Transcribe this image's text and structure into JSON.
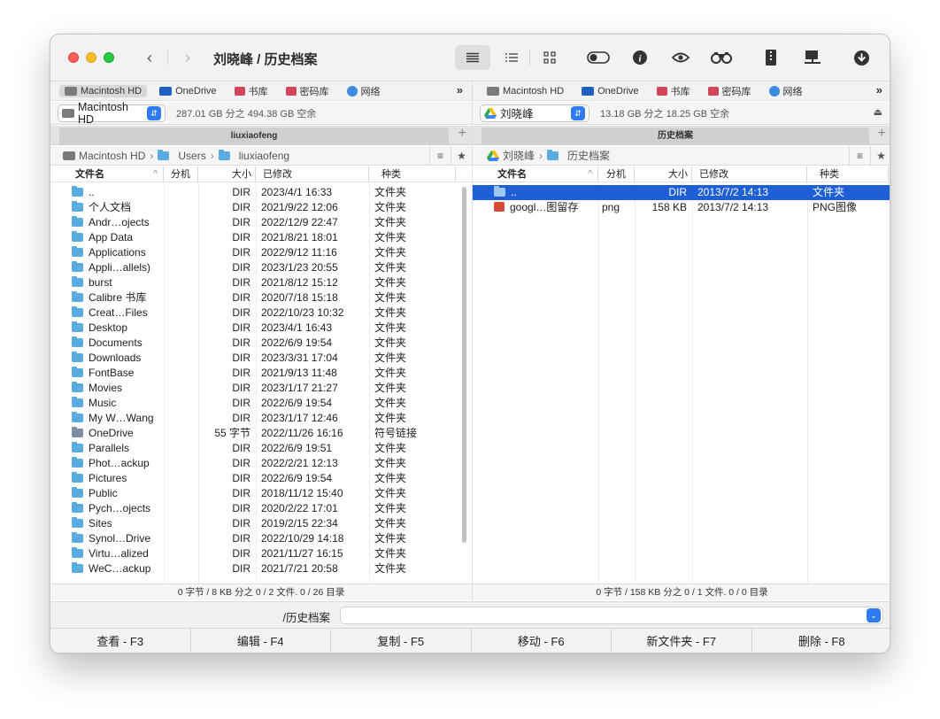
{
  "window": {
    "title": "刘晓峰 / 历史档案"
  },
  "toolbar": {
    "icons": [
      "list-view-icon",
      "detail-view-icon",
      "grid-view-icon",
      "toggle-icon",
      "info-icon",
      "eye-icon",
      "binoculars-icon",
      "archive-icon",
      "network-drive-icon",
      "download-icon"
    ]
  },
  "volumes_left": [
    {
      "label": "Macintosh HD",
      "icon": "hdd-icon",
      "selected": true
    },
    {
      "label": "OneDrive",
      "icon": "drive-icon",
      "selected": false
    },
    {
      "label": "书库",
      "icon": "drive-icon",
      "selected": false
    },
    {
      "label": "密码库",
      "icon": "drive-icon",
      "selected": false
    },
    {
      "label": "网络",
      "icon": "globe-icon",
      "selected": false
    }
  ],
  "volumes_right": [
    {
      "label": "Macintosh HD",
      "icon": "hdd-icon",
      "selected": false
    },
    {
      "label": "OneDrive",
      "icon": "drive-icon",
      "selected": false
    },
    {
      "label": "书库",
      "icon": "drive-icon",
      "selected": false
    },
    {
      "label": "密码库",
      "icon": "drive-icon",
      "selected": false
    },
    {
      "label": "网络",
      "icon": "globe-icon",
      "selected": false
    }
  ],
  "volumes_more": "»",
  "left": {
    "drive": "Macintosh HD",
    "space": "287.01 GB 分之 494.38 GB 空余",
    "tab": "liuxiaofeng",
    "crumbs": [
      "Macintosh HD",
      "Users",
      "liuxiaofeng"
    ],
    "columns": [
      "文件名",
      "分机",
      "大小",
      "已修改",
      "种类"
    ],
    "sort_indicator": "^",
    "rows": [
      {
        "name": "..",
        "ext": "",
        "size": "DIR",
        "modified": "2023/4/1 16:33",
        "kind": "文件夹",
        "icon": "folder"
      },
      {
        "name": "个人文档",
        "ext": "",
        "size": "DIR",
        "modified": "2021/9/22 12:06",
        "kind": "文件夹",
        "icon": "folder"
      },
      {
        "name": "Andr…ojects",
        "ext": "",
        "size": "DIR",
        "modified": "2022/12/9 22:47",
        "kind": "文件夹",
        "icon": "folder"
      },
      {
        "name": "App Data",
        "ext": "",
        "size": "DIR",
        "modified": "2021/8/21 18:01",
        "kind": "文件夹",
        "icon": "folder"
      },
      {
        "name": "Applications",
        "ext": "",
        "size": "DIR",
        "modified": "2022/9/12 11:16",
        "kind": "文件夹",
        "icon": "folder"
      },
      {
        "name": "Appli…allels)",
        "ext": "",
        "size": "DIR",
        "modified": "2023/1/23 20:55",
        "kind": "文件夹",
        "icon": "folder"
      },
      {
        "name": "burst",
        "ext": "",
        "size": "DIR",
        "modified": "2021/8/12 15:12",
        "kind": "文件夹",
        "icon": "folder"
      },
      {
        "name": "Calibre 书库",
        "ext": "",
        "size": "DIR",
        "modified": "2020/7/18 15:18",
        "kind": "文件夹",
        "icon": "folder"
      },
      {
        "name": "Creat…Files",
        "ext": "",
        "size": "DIR",
        "modified": "2022/10/23 10:32",
        "kind": "文件夹",
        "icon": "folder"
      },
      {
        "name": "Desktop",
        "ext": "",
        "size": "DIR",
        "modified": "2023/4/1 16:43",
        "kind": "文件夹",
        "icon": "folder"
      },
      {
        "name": "Documents",
        "ext": "",
        "size": "DIR",
        "modified": "2022/6/9 19:54",
        "kind": "文件夹",
        "icon": "folder"
      },
      {
        "name": "Downloads",
        "ext": "",
        "size": "DIR",
        "modified": "2023/3/31 17:04",
        "kind": "文件夹",
        "icon": "folder"
      },
      {
        "name": "FontBase",
        "ext": "",
        "size": "DIR",
        "modified": "2021/9/13 11:48",
        "kind": "文件夹",
        "icon": "folder"
      },
      {
        "name": "Movies",
        "ext": "",
        "size": "DIR",
        "modified": "2023/1/17 21:27",
        "kind": "文件夹",
        "icon": "folder"
      },
      {
        "name": "Music",
        "ext": "",
        "size": "DIR",
        "modified": "2022/6/9 19:54",
        "kind": "文件夹",
        "icon": "folder"
      },
      {
        "name": "My W…Wang",
        "ext": "",
        "size": "DIR",
        "modified": "2023/1/17 12:46",
        "kind": "文件夹",
        "icon": "folder"
      },
      {
        "name": "OneDrive",
        "ext": "",
        "size": "55 字节",
        "modified": "2022/11/26 16:16",
        "kind": "符号链接",
        "icon": "link"
      },
      {
        "name": "Parallels",
        "ext": "",
        "size": "DIR",
        "modified": "2022/6/9 19:51",
        "kind": "文件夹",
        "icon": "folder"
      },
      {
        "name": "Phot…ackup",
        "ext": "",
        "size": "DIR",
        "modified": "2022/2/21 12:13",
        "kind": "文件夹",
        "icon": "folder"
      },
      {
        "name": "Pictures",
        "ext": "",
        "size": "DIR",
        "modified": "2022/6/9 19:54",
        "kind": "文件夹",
        "icon": "folder"
      },
      {
        "name": "Public",
        "ext": "",
        "size": "DIR",
        "modified": "2018/11/12 15:40",
        "kind": "文件夹",
        "icon": "folder"
      },
      {
        "name": "Pych…ojects",
        "ext": "",
        "size": "DIR",
        "modified": "2020/2/22 17:01",
        "kind": "文件夹",
        "icon": "folder"
      },
      {
        "name": "Sites",
        "ext": "",
        "size": "DIR",
        "modified": "2019/2/15 22:34",
        "kind": "文件夹",
        "icon": "folder"
      },
      {
        "name": "Synol…Drive",
        "ext": "",
        "size": "DIR",
        "modified": "2022/10/29 14:18",
        "kind": "文件夹",
        "icon": "folder"
      },
      {
        "name": "Virtu…alized",
        "ext": "",
        "size": "DIR",
        "modified": "2021/11/27 16:15",
        "kind": "文件夹",
        "icon": "folder"
      },
      {
        "name": "WeC…ackup",
        "ext": "",
        "size": "DIR",
        "modified": "2021/7/21 20:58",
        "kind": "文件夹",
        "icon": "folder"
      }
    ],
    "status": "0 字节 / 8 KB 分之 0 / 2 文件. 0 / 26 目录"
  },
  "right": {
    "drive": "刘晓峰",
    "space": "13.18 GB 分之 18.25 GB 空余",
    "tab": "历史档案",
    "crumbs": [
      "刘晓峰",
      "历史档案"
    ],
    "columns": [
      "文件名",
      "分机",
      "大小",
      "已修改",
      "种类"
    ],
    "sort_indicator": "^",
    "rows": [
      {
        "name": "..",
        "ext": "",
        "size": "DIR",
        "modified": "2013/7/2 14:13",
        "kind": "文件夹",
        "icon": "folder",
        "selected": true
      },
      {
        "name": "googl…图留存",
        "ext": "png",
        "size": "158 KB",
        "modified": "2013/7/2 14:13",
        "kind": "PNG图像",
        "icon": "img",
        "selected": false
      }
    ],
    "status": "0 字节 / 158 KB 分之 0 / 1 文件. 0 / 0 目录"
  },
  "cmdline": {
    "path": "/历史档案",
    "value": ""
  },
  "fkeys": [
    "查看 - F3",
    "编辑 - F4",
    "复制 - F5",
    "移动 - F6",
    "新文件夹 - F7",
    "删除 - F8"
  ],
  "colors": {
    "selection": "#1e5fd6",
    "folder": "#5aabdf",
    "accent": "#2f7bf5"
  }
}
